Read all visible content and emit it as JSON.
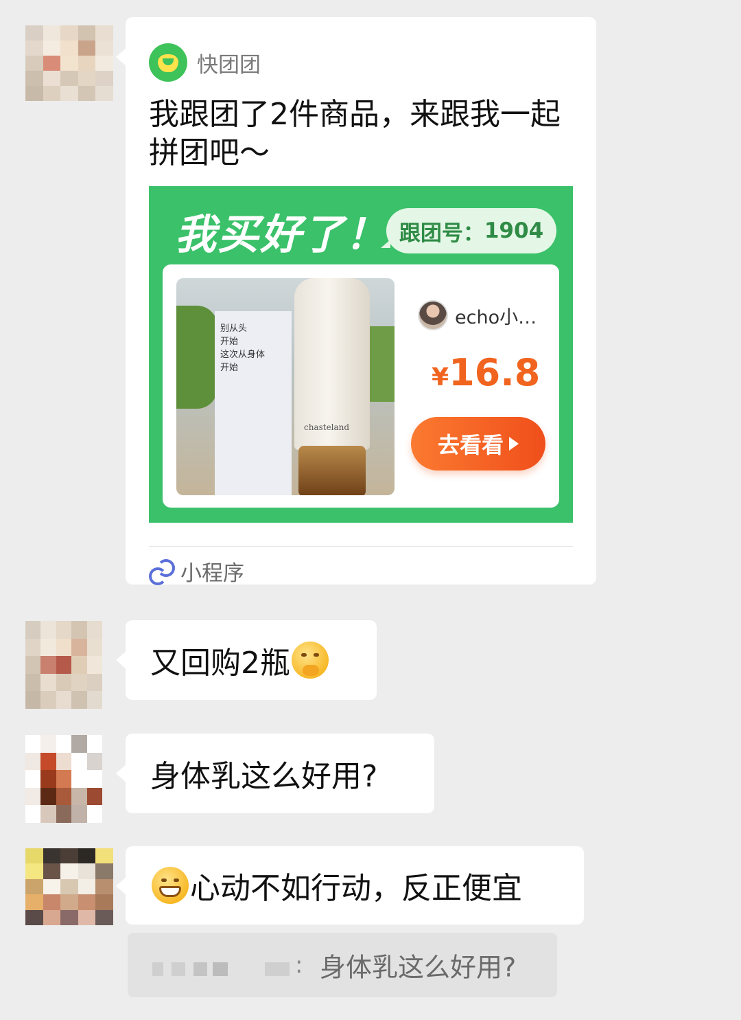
{
  "mini_program_card": {
    "app_name": "快团团",
    "title": "我跟团了2件商品，来跟我一起拼团吧～",
    "banner_headline": "我买好了！",
    "group_label": "跟团号：",
    "group_number": "1904",
    "product_image_text": "别从头\n开始\n这次从身体\n开始",
    "product_bottle_text": "chasteland",
    "seller_name": "echo小…",
    "price_symbol": "¥",
    "price": "16.8",
    "go_button": "去看看",
    "footer_label": "小程序"
  },
  "messages": [
    {
      "text": "又回购2瓶",
      "emoji": "thinking-face"
    },
    {
      "text": "身体乳这么好用?"
    },
    {
      "text": "心动不如行动，反正便宜",
      "emoji": "grinning-face"
    }
  ],
  "quote": {
    "separator": ":",
    "text": "身体乳这么好用?"
  },
  "colors": {
    "background": "#ededed",
    "bubble": "#ffffff",
    "banner_green": "#3bc16a",
    "price_orange": "#f0641f",
    "button_orange": "#f04f1b"
  }
}
